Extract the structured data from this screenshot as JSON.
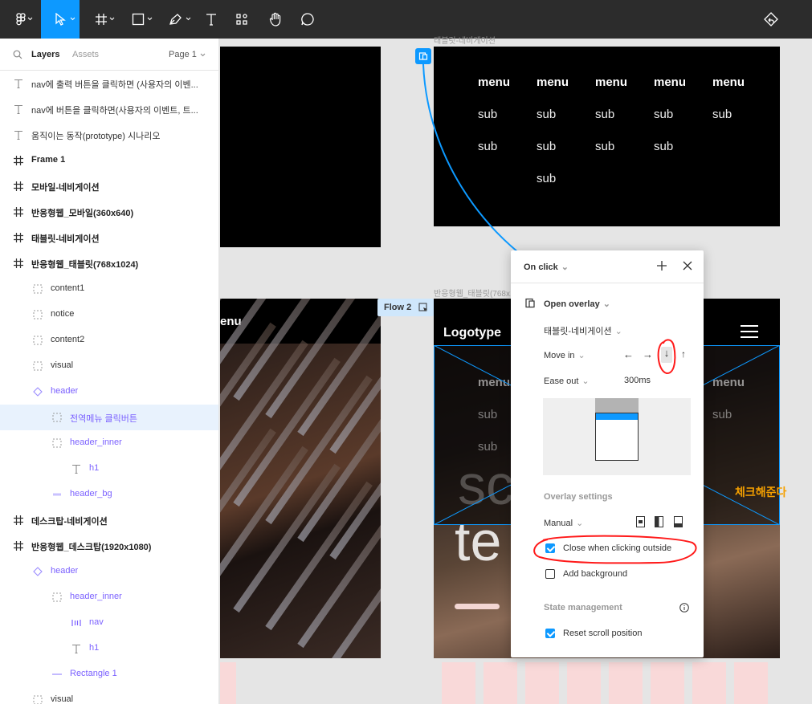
{
  "panel": {
    "tabs": [
      "Layers",
      "Assets"
    ],
    "page": "Page 1",
    "layers": [
      {
        "label": "nav에 출력 버튼을 클릭하면 (사용자의 이벤...",
        "icon": "text",
        "indent": 0,
        "style": "grey"
      },
      {
        "label": "nav에 버튼을 클릭하면(사용자의 이벤트, 트...",
        "icon": "text",
        "indent": 0,
        "style": "grey"
      },
      {
        "label": "움직이는 동작(prototype) 시나리오",
        "icon": "text",
        "indent": 0,
        "style": "grey"
      },
      {
        "label": "Frame 1",
        "icon": "frame",
        "indent": 0,
        "style": "bold"
      },
      {
        "label": "모바일-네비게이션",
        "icon": "frame",
        "indent": 0,
        "style": "bold"
      },
      {
        "label": "반응형웹_모바일(360x640)",
        "icon": "frame",
        "indent": 0,
        "style": "bold"
      },
      {
        "label": "태블릿-네비게이션",
        "icon": "frame",
        "indent": 0,
        "style": "bold"
      },
      {
        "label": "반응형웹_태블릿(768x1024)",
        "icon": "frame",
        "indent": 0,
        "style": "bold"
      },
      {
        "label": "content1",
        "icon": "group",
        "indent": 1,
        "style": "grey"
      },
      {
        "label": "notice",
        "icon": "group",
        "indent": 1,
        "style": "grey"
      },
      {
        "label": "content2",
        "icon": "group",
        "indent": 1,
        "style": "grey"
      },
      {
        "label": "visual",
        "icon": "group",
        "indent": 1,
        "style": "grey"
      },
      {
        "label": "header",
        "icon": "component",
        "indent": 1,
        "style": "purple"
      },
      {
        "label": "전역메뉴 클릭버튼",
        "icon": "group",
        "indent": 2,
        "style": "purple",
        "selected": true
      },
      {
        "label": "header_inner",
        "icon": "group",
        "indent": 2,
        "style": "purple"
      },
      {
        "label": "h1",
        "icon": "text",
        "indent": 3,
        "style": "purple"
      },
      {
        "label": "header_bg",
        "icon": "rect",
        "indent": 2,
        "style": "purple"
      },
      {
        "label": "데스크탑-네비게이션",
        "icon": "frame",
        "indent": 0,
        "style": "bold"
      },
      {
        "label": "반응형웹_데스크탑(1920x1080)",
        "icon": "frame",
        "indent": 0,
        "style": "bold"
      },
      {
        "label": "header",
        "icon": "component",
        "indent": 1,
        "style": "purple"
      },
      {
        "label": "header_inner",
        "icon": "group",
        "indent": 2,
        "style": "purple"
      },
      {
        "label": "nav",
        "icon": "autolayout",
        "indent": 3,
        "style": "purple"
      },
      {
        "label": "h1",
        "icon": "text",
        "indent": 3,
        "style": "purple"
      },
      {
        "label": "Rectangle 1",
        "icon": "line",
        "indent": 2,
        "style": "purple"
      },
      {
        "label": "visual",
        "icon": "group",
        "indent": 1,
        "style": "grey"
      }
    ]
  },
  "canvas": {
    "frame_label_nav": "태블릿-네비게이션",
    "frame_label_tablet": "반응형웹_태블릿(768x1024)",
    "flow_label": "Flow 2",
    "logotype": "Logotype",
    "mobile_menu_text": "enu",
    "hero_sc": "sc",
    "hero_te": "te",
    "menu_header": "menu",
    "menu_sub": "sub",
    "nav_menu": [
      {
        "header": "menu",
        "subs": [
          "sub",
          "sub"
        ]
      },
      {
        "header": "menu",
        "subs": [
          "sub",
          "sub",
          "sub"
        ]
      },
      {
        "header": "menu",
        "subs": [
          "sub",
          "sub"
        ]
      },
      {
        "header": "menu",
        "subs": [
          "sub",
          "sub"
        ]
      },
      {
        "header": "menu",
        "subs": [
          "sub"
        ]
      }
    ],
    "annotation": "체크해준다"
  },
  "popup": {
    "trigger": "On click",
    "action": "Open overlay",
    "destination": "태블릿-네비게이션",
    "animation": "Move in",
    "arrows": [
      "←",
      "→",
      "↓",
      "↑"
    ],
    "easing": "Ease out",
    "duration": "300ms",
    "overlay_settings_heading": "Overlay settings",
    "position": "Manual",
    "close_outside": "Close when clicking outside",
    "add_background": "Add background",
    "state_heading": "State management",
    "reset_scroll": "Reset scroll position"
  },
  "colors": {
    "accent": "#0d99ff",
    "toolbar": "#2c2c2c",
    "component_purple": "#7b61ff",
    "annotation": "#f5a000",
    "highlight_red": "#ff1a1a"
  }
}
